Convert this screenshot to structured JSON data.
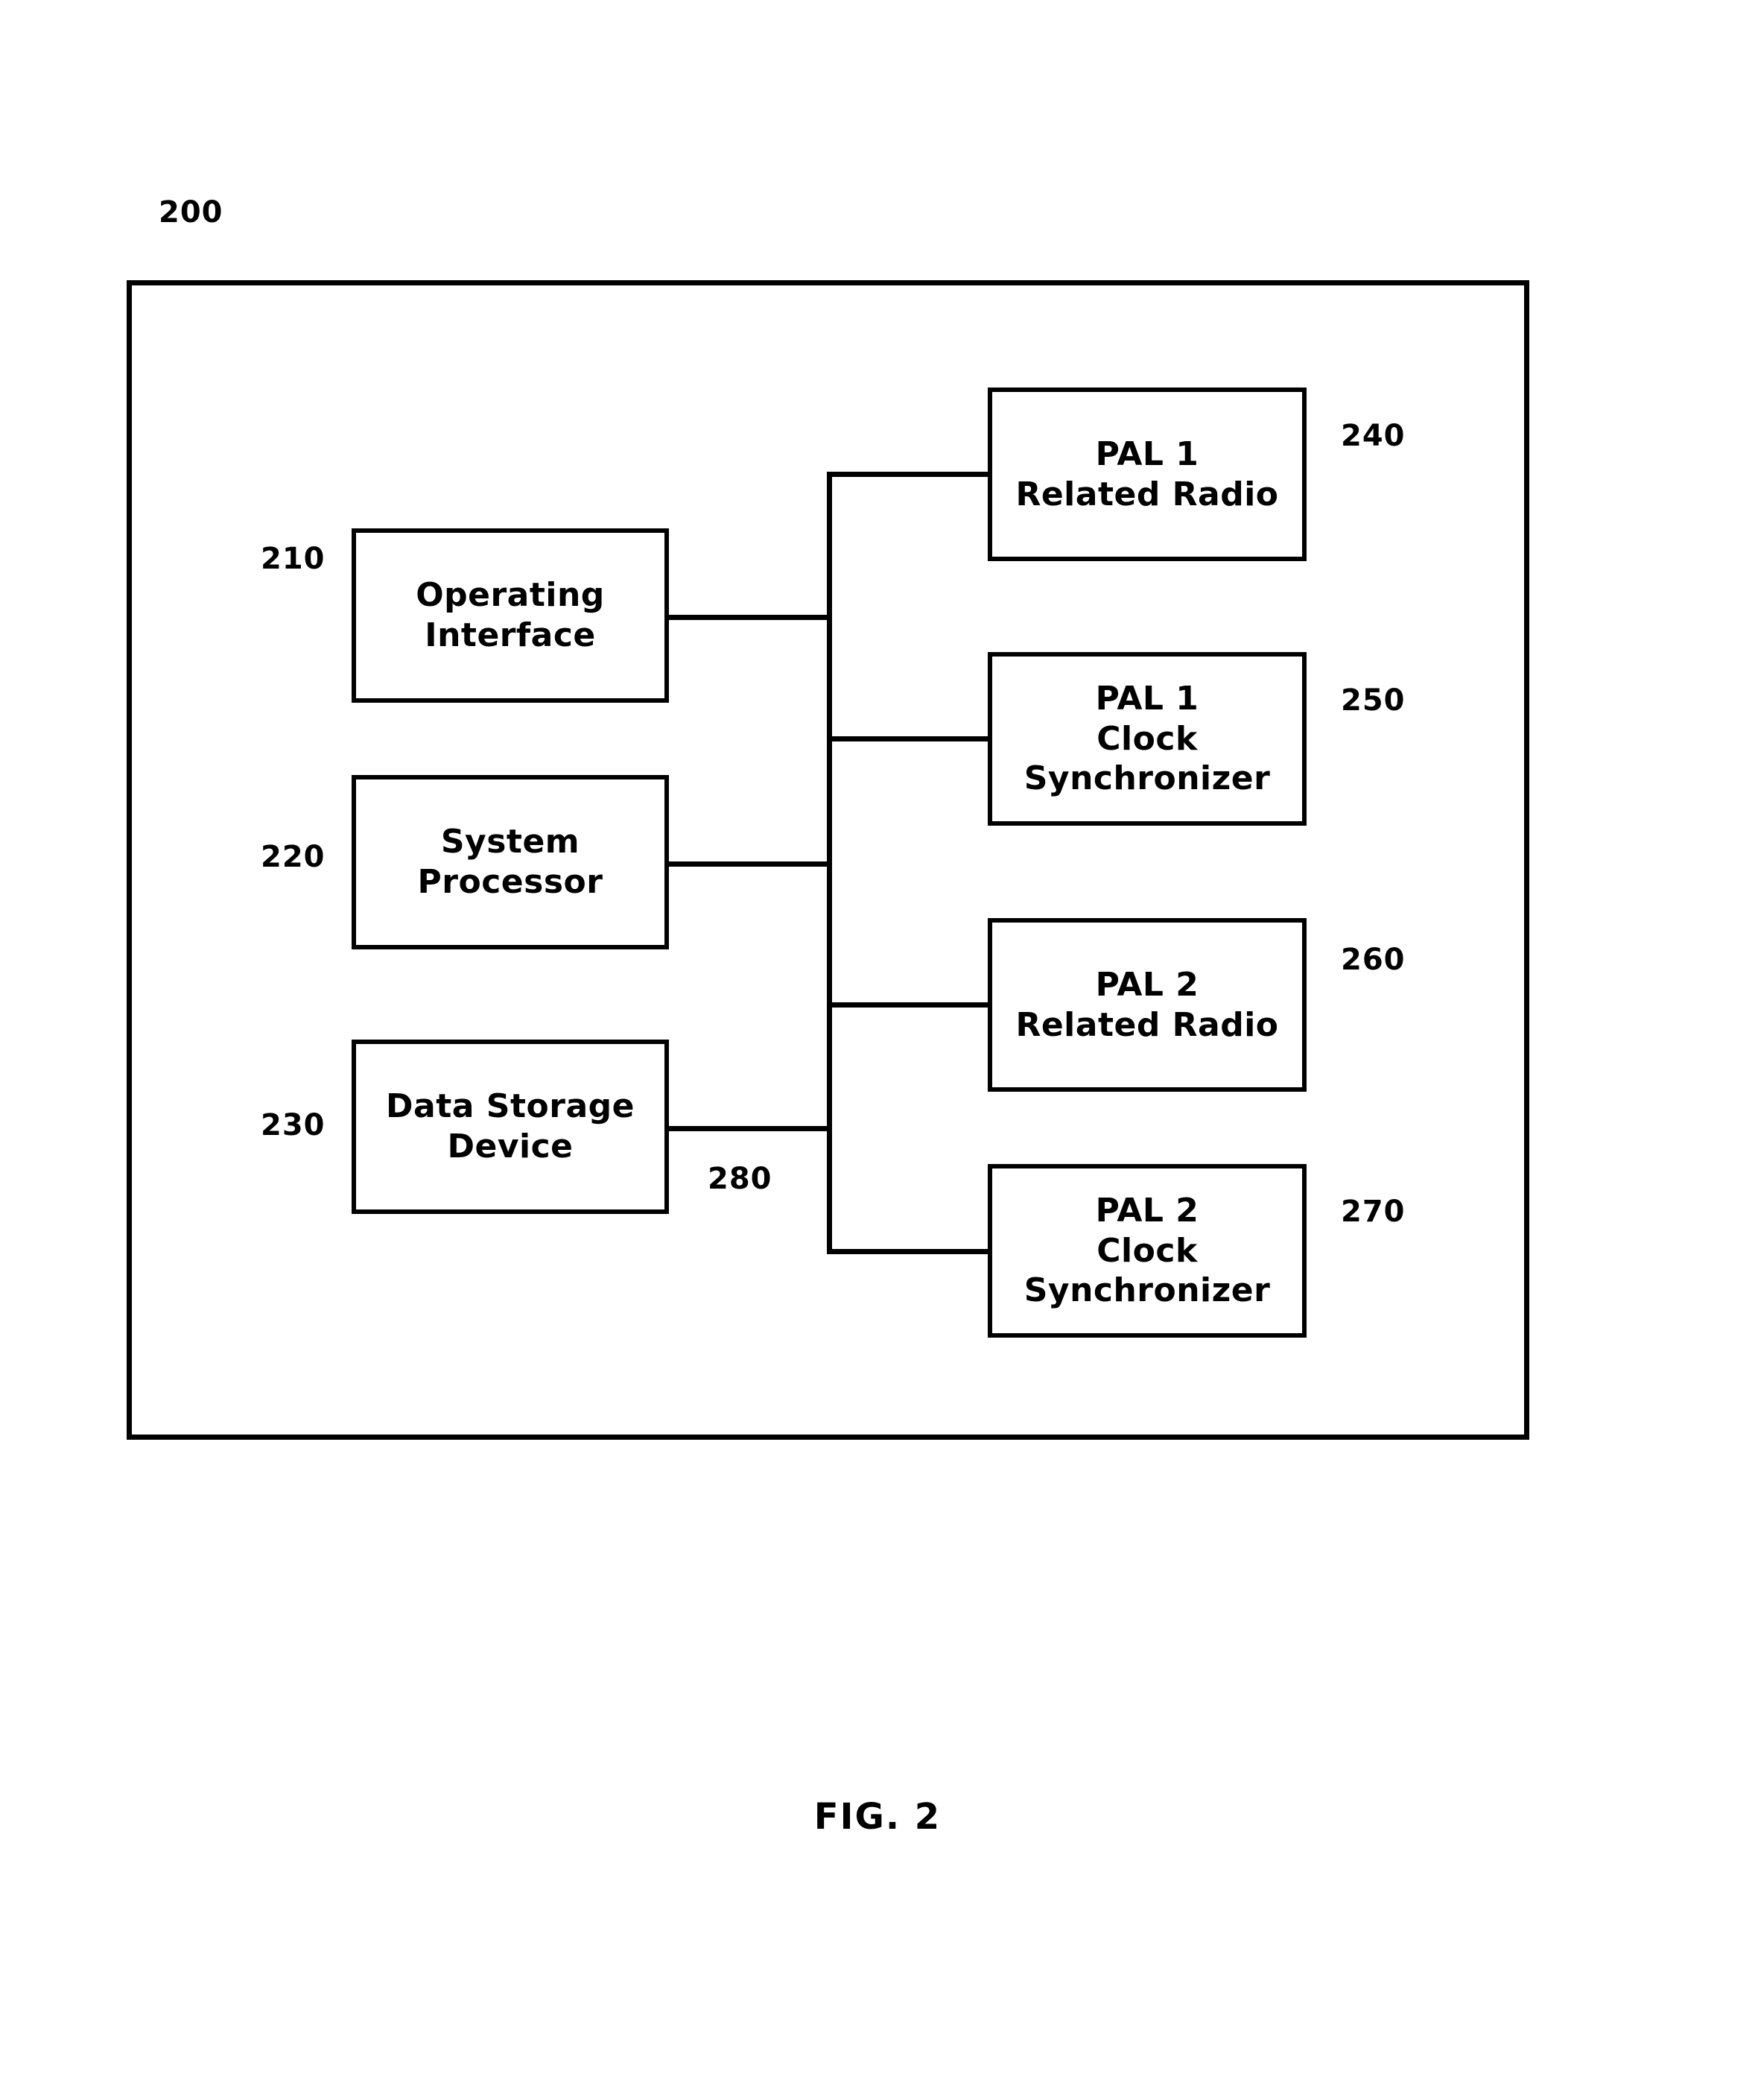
{
  "figure": {
    "caption": "FIG. 2",
    "system_ref": "200"
  },
  "blocks": [
    {
      "ref": "210",
      "name": "operating-interface",
      "lines": [
        "Operating",
        "Interface"
      ],
      "ref_side": "left"
    },
    {
      "ref": "220",
      "name": "system-processor",
      "lines": [
        "System",
        "Processor"
      ],
      "ref_side": "left"
    },
    {
      "ref": "230",
      "name": "data-storage-device",
      "lines": [
        "Data Storage",
        "Device"
      ],
      "ref_side": "left"
    },
    {
      "ref": "240",
      "name": "pal-1-related-radio",
      "lines": [
        "PAL 1",
        "Related Radio"
      ],
      "ref_side": "right"
    },
    {
      "ref": "250",
      "name": "pal-1-clock-synchronizer",
      "lines": [
        "PAL 1",
        "Clock",
        "Synchronizer"
      ],
      "ref_side": "right"
    },
    {
      "ref": "260",
      "name": "pal-2-related-radio",
      "lines": [
        "PAL 2",
        "Related Radio"
      ],
      "ref_side": "right"
    },
    {
      "ref": "270",
      "name": "pal-2-clock-synchronizer",
      "lines": [
        "PAL 2",
        "Clock",
        "Synchronizer"
      ],
      "ref_side": "right"
    }
  ],
  "bus": {
    "ref": "280",
    "name": "system-bus"
  },
  "style": {
    "ink": "#000000",
    "paper": "#ffffff"
  }
}
